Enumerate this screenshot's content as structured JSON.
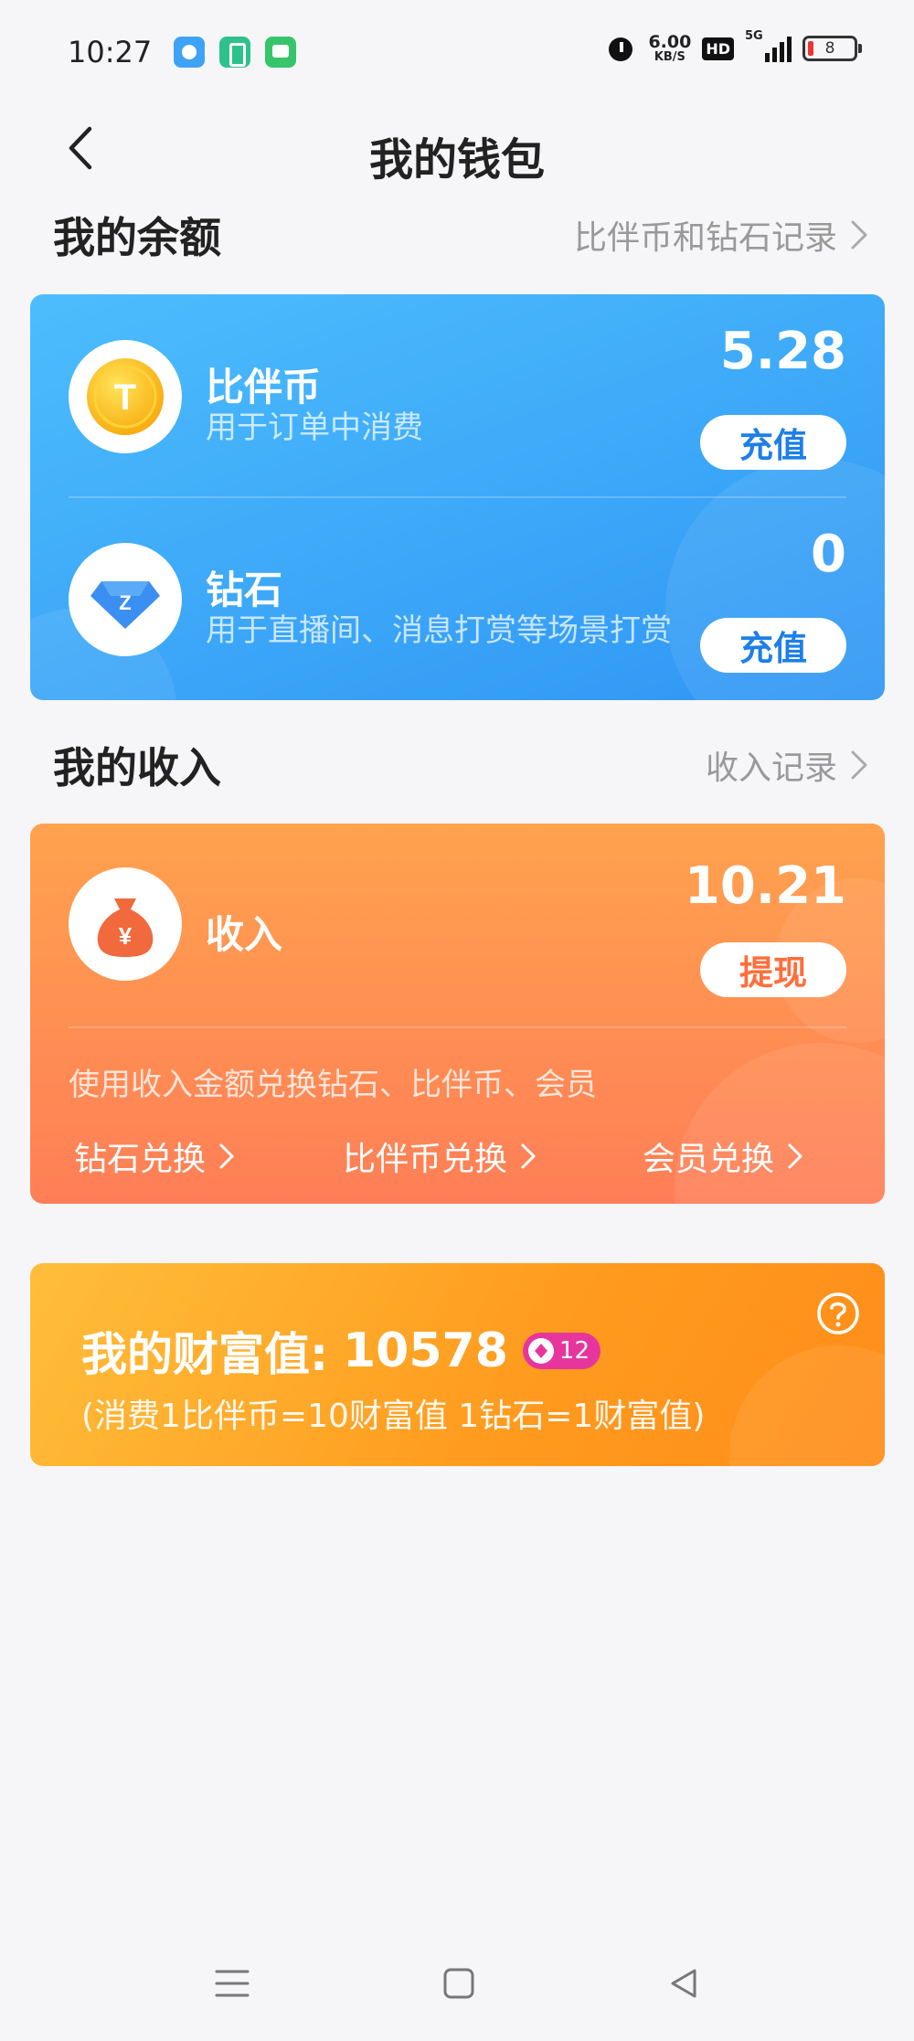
{
  "status_bar": {
    "time": "10:27",
    "net_speed": "6.00",
    "net_unit": "KB/S",
    "hd": "HD",
    "network": "5G",
    "battery": "8"
  },
  "header": {
    "title": "我的钱包"
  },
  "balance": {
    "title": "我的余额",
    "link": "比伴币和钻石记录",
    "coin": {
      "name": "比伴币",
      "desc": "用于订单中消费",
      "amount": "5.28",
      "button": "充值",
      "icon_letter": "T"
    },
    "diamond": {
      "name": "钻石",
      "desc": "用于直播间、消息打赏等场景打赏",
      "amount": "0",
      "button": "充值",
      "icon_letter": "Z"
    }
  },
  "income": {
    "title": "我的收入",
    "link": "收入记录",
    "label": "收入",
    "amount": "10.21",
    "button": "提现",
    "icon_symbol": "¥",
    "desc": "使用收入金额兑换钻石、比伴币、会员",
    "exchanges": [
      "钻石兑换",
      "比伴币兑换",
      "会员兑换"
    ]
  },
  "wealth": {
    "label": "我的财富值:",
    "value": "10578",
    "level": "12",
    "note": "(消费1比伴币=10财富值 1钻石=1财富值)"
  },
  "colors": {
    "blue_card": "#3aa5f8",
    "orange_card": "#ff8d52",
    "gold_card": "#ffa62a",
    "level_badge": "#e7359e"
  },
  "icons": [
    "back-icon",
    "chevron-right-icon",
    "coin-icon",
    "diamond-icon",
    "money-bag-icon",
    "help-icon",
    "menu-icon",
    "home-icon",
    "back-triangle-icon"
  ]
}
